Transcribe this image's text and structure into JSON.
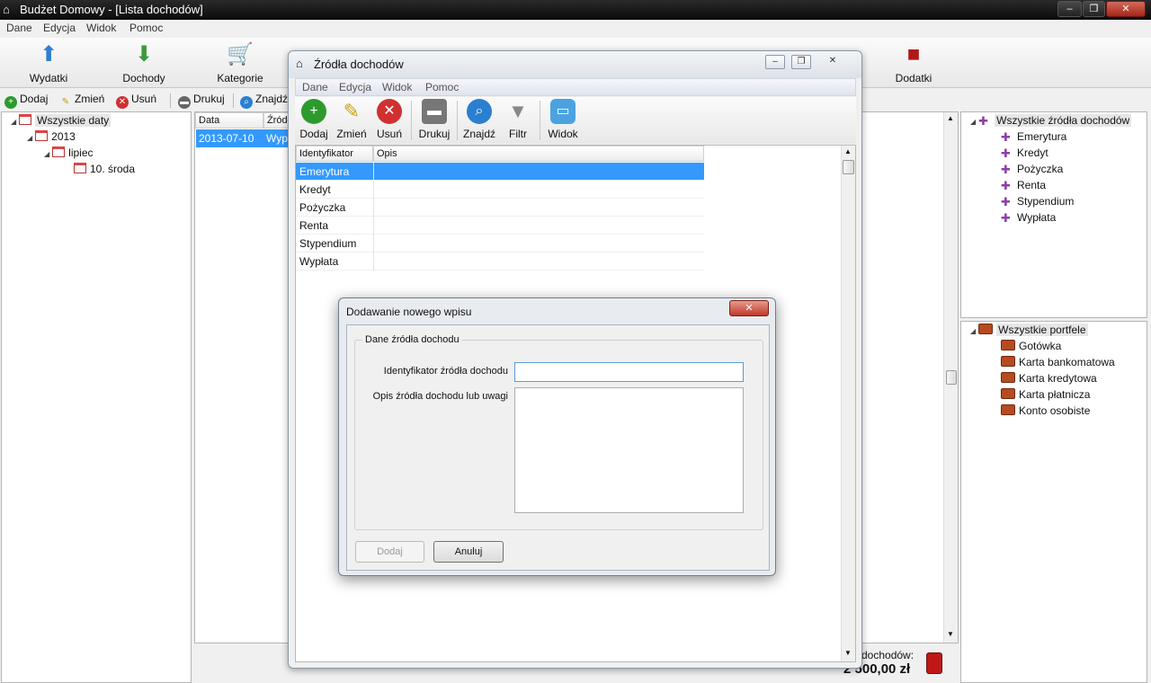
{
  "app": {
    "title": "Budżet Domowy - [Lista dochodów]",
    "min": "‒",
    "max": "❐",
    "close": "✕"
  },
  "menu": [
    "Dane",
    "Edycja",
    "Widok",
    "Pomoc"
  ],
  "bigbar": {
    "wydatki": "Wydatki",
    "dochody": "Dochody",
    "kategorie": "Kategorie",
    "dodatki": "Dodatki"
  },
  "smallbar": {
    "dodaj": "Dodaj",
    "zmien": "Zmień",
    "usun": "Usuń",
    "drukuj": "Drukuj",
    "znajdz": "Znajdź"
  },
  "date_tree": {
    "root": "Wszystkie daty",
    "year": "2013",
    "month": "lipiec",
    "day": "10. środa"
  },
  "grid": {
    "col_date": "Data",
    "col_source": "Źródło",
    "row_date": "2013-07-10",
    "row_source": "Wypł"
  },
  "sources_tree": {
    "root": "Wszystkie źródła dochodów",
    "items": [
      "Emerytura",
      "Kredyt",
      "Pożyczka",
      "Renta",
      "Stypendium",
      "Wypłata"
    ]
  },
  "wallets_tree": {
    "root": "Wszystkie portfele",
    "items": [
      "Gotówka",
      "Karta bankomatowa",
      "Karta kredytowa",
      "Karta płatnicza",
      "Konto osobiste"
    ]
  },
  "summary": {
    "label": "dochodów:",
    "amount": "2 500,00  zł"
  },
  "sources_window": {
    "title": "Źródła dochodów",
    "menu": [
      "Dane",
      "Edycja",
      "Widok",
      "Pomoc"
    ],
    "toolbar": {
      "dodaj": "Dodaj",
      "zmien": "Zmień",
      "usun": "Usuń",
      "drukuj": "Drukuj",
      "znajdz": "Znajdź",
      "filtr": "Filtr",
      "widok": "Widok"
    },
    "col_id": "Identyfikator",
    "col_desc": "Opis",
    "rows": [
      "Emerytura",
      "Kredyt",
      "Pożyczka",
      "Renta",
      "Stypendium",
      "Wypłata"
    ]
  },
  "dialog": {
    "title": "Dodawanie nowego wpisu",
    "group": "Dane źródła dochodu",
    "id_label": "Identyfikator źródła dochodu",
    "desc_label": "Opis źródła dochodu lub uwagi",
    "id_value": "",
    "desc_value": "",
    "add_btn": "Dodaj",
    "cancel_btn": "Anuluj"
  },
  "colors": {
    "selection": "#3399ff",
    "titlebar": "#1a1a1a"
  }
}
